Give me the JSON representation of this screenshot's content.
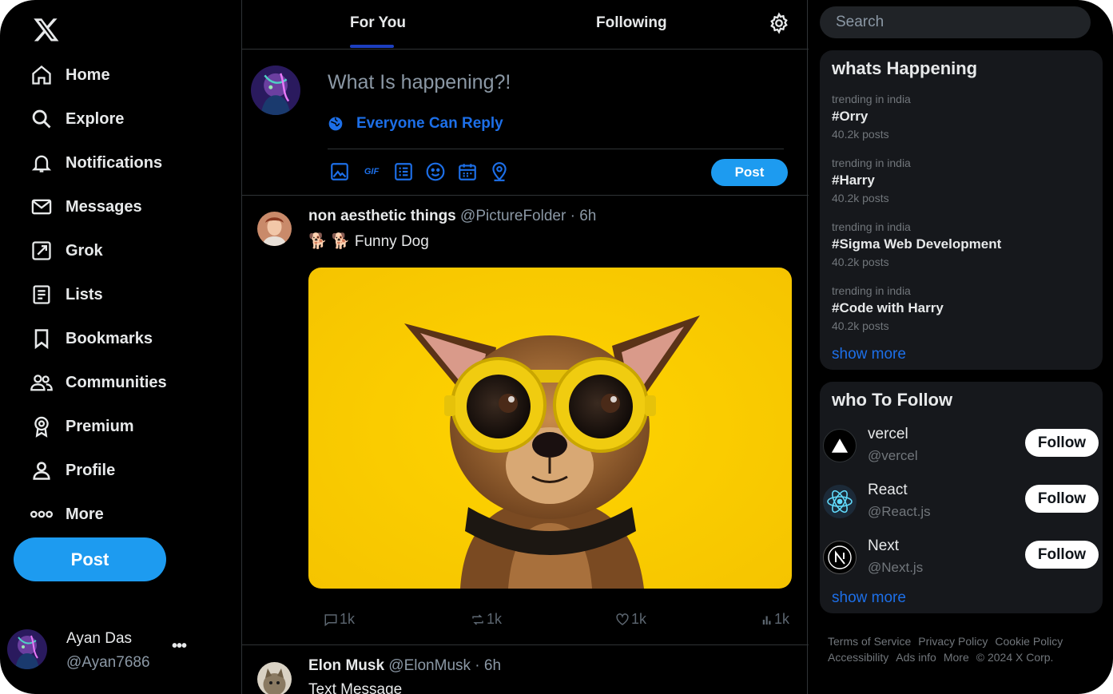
{
  "nav": {
    "items": [
      {
        "label": "Home",
        "icon": "home-icon"
      },
      {
        "label": "Explore",
        "icon": "search-icon"
      },
      {
        "label": "Notifications",
        "icon": "bell-icon"
      },
      {
        "label": "Messages",
        "icon": "envelope-icon"
      },
      {
        "label": "Grok",
        "icon": "grok-icon"
      },
      {
        "label": "Lists",
        "icon": "list-icon"
      },
      {
        "label": "Bookmarks",
        "icon": "bookmark-icon"
      },
      {
        "label": "Communities",
        "icon": "people-icon"
      },
      {
        "label": "Premium",
        "icon": "badge-icon"
      },
      {
        "label": "Profile",
        "icon": "person-icon"
      },
      {
        "label": "More",
        "icon": "more-icon"
      }
    ],
    "post_label": "Post"
  },
  "account": {
    "name": "Ayan Das",
    "handle": "@Ayan7686",
    "menu": "•••"
  },
  "tabs": {
    "for_you": "For You",
    "following": "Following"
  },
  "composer": {
    "placeholder": "What Is happening?!",
    "reply_setting": "Everyone Can Reply",
    "gif_label": "GIF",
    "post_label": "Post"
  },
  "tweets": [
    {
      "author": "non aesthetic things",
      "meta": "@PictureFolder · 6h",
      "text": "🐕 🐕 Funny Dog",
      "replies": "1k",
      "retweets": "1k",
      "likes": "1k",
      "views": "1k"
    },
    {
      "author": "Elon Musk",
      "meta": "@ElonMusk · 6h",
      "text": "Text Message"
    }
  ],
  "search": {
    "placeholder": "Search"
  },
  "happening": {
    "title": "whats Happening",
    "trends": [
      {
        "context": "trending in india",
        "tag": "#Orry",
        "count": "40.2k posts"
      },
      {
        "context": "trending in india",
        "tag": "#Harry",
        "count": "40.2k posts"
      },
      {
        "context": "trending in india",
        "tag": "#Sigma Web Development",
        "count": "40.2k posts"
      },
      {
        "context": "trending in india",
        "tag": "#Code with Harry",
        "count": "40.2k posts"
      }
    ],
    "show_more": "show more"
  },
  "who_to_follow": {
    "title": "who To Follow",
    "accounts": [
      {
        "name": "vercel",
        "handle": "@vercel",
        "button": "Follow"
      },
      {
        "name": "React",
        "handle": "@React.js",
        "button": "Follow"
      },
      {
        "name": "Next",
        "handle": "@Next.js",
        "button": "Follow"
      }
    ],
    "show_more": "show more"
  },
  "footer": {
    "links": [
      "Terms of Service",
      "Privacy Policy",
      "Cookie Policy",
      "Accessibility",
      "Ads info",
      "More",
      "© 2024 X Corp."
    ]
  },
  "colors": {
    "accent": "#1d9bf0",
    "link": "#1d6fe8",
    "background": "#000000",
    "card": "#16181c"
  }
}
